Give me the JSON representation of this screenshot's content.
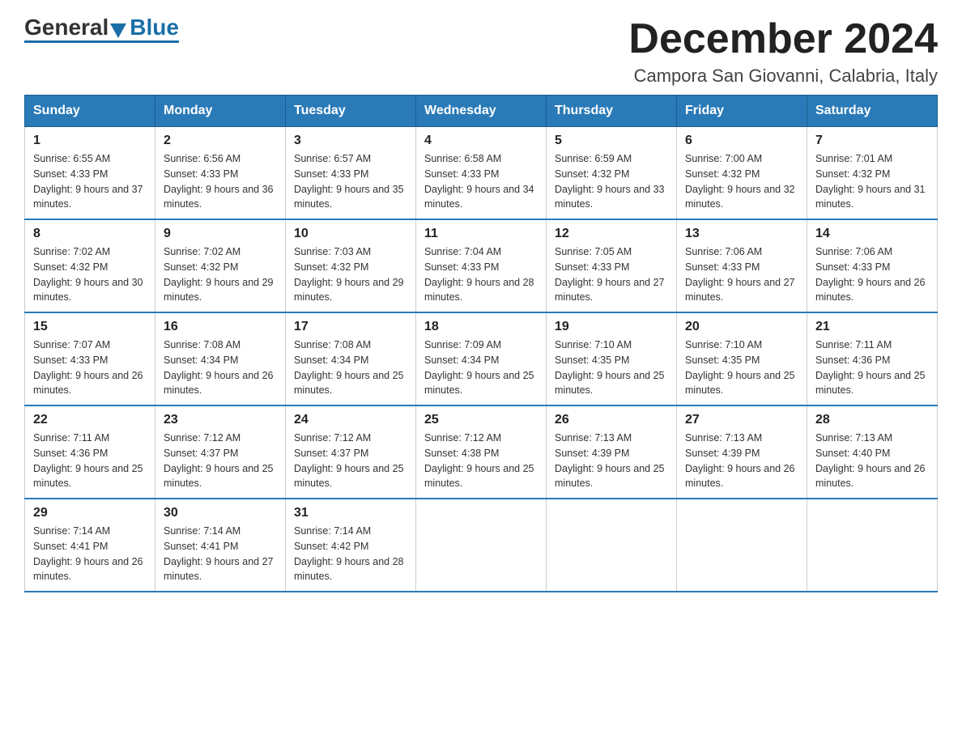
{
  "logo": {
    "general": "General",
    "blue": "Blue"
  },
  "title": "December 2024",
  "subtitle": "Campora San Giovanni, Calabria, Italy",
  "days_of_week": [
    "Sunday",
    "Monday",
    "Tuesday",
    "Wednesday",
    "Thursday",
    "Friday",
    "Saturday"
  ],
  "weeks": [
    [
      {
        "day": "1",
        "sunrise": "6:55 AM",
        "sunset": "4:33 PM",
        "daylight": "9 hours and 37 minutes."
      },
      {
        "day": "2",
        "sunrise": "6:56 AM",
        "sunset": "4:33 PM",
        "daylight": "9 hours and 36 minutes."
      },
      {
        "day": "3",
        "sunrise": "6:57 AM",
        "sunset": "4:33 PM",
        "daylight": "9 hours and 35 minutes."
      },
      {
        "day": "4",
        "sunrise": "6:58 AM",
        "sunset": "4:33 PM",
        "daylight": "9 hours and 34 minutes."
      },
      {
        "day": "5",
        "sunrise": "6:59 AM",
        "sunset": "4:32 PM",
        "daylight": "9 hours and 33 minutes."
      },
      {
        "day": "6",
        "sunrise": "7:00 AM",
        "sunset": "4:32 PM",
        "daylight": "9 hours and 32 minutes."
      },
      {
        "day": "7",
        "sunrise": "7:01 AM",
        "sunset": "4:32 PM",
        "daylight": "9 hours and 31 minutes."
      }
    ],
    [
      {
        "day": "8",
        "sunrise": "7:02 AM",
        "sunset": "4:32 PM",
        "daylight": "9 hours and 30 minutes."
      },
      {
        "day": "9",
        "sunrise": "7:02 AM",
        "sunset": "4:32 PM",
        "daylight": "9 hours and 29 minutes."
      },
      {
        "day": "10",
        "sunrise": "7:03 AM",
        "sunset": "4:32 PM",
        "daylight": "9 hours and 29 minutes."
      },
      {
        "day": "11",
        "sunrise": "7:04 AM",
        "sunset": "4:33 PM",
        "daylight": "9 hours and 28 minutes."
      },
      {
        "day": "12",
        "sunrise": "7:05 AM",
        "sunset": "4:33 PM",
        "daylight": "9 hours and 27 minutes."
      },
      {
        "day": "13",
        "sunrise": "7:06 AM",
        "sunset": "4:33 PM",
        "daylight": "9 hours and 27 minutes."
      },
      {
        "day": "14",
        "sunrise": "7:06 AM",
        "sunset": "4:33 PM",
        "daylight": "9 hours and 26 minutes."
      }
    ],
    [
      {
        "day": "15",
        "sunrise": "7:07 AM",
        "sunset": "4:33 PM",
        "daylight": "9 hours and 26 minutes."
      },
      {
        "day": "16",
        "sunrise": "7:08 AM",
        "sunset": "4:34 PM",
        "daylight": "9 hours and 26 minutes."
      },
      {
        "day": "17",
        "sunrise": "7:08 AM",
        "sunset": "4:34 PM",
        "daylight": "9 hours and 25 minutes."
      },
      {
        "day": "18",
        "sunrise": "7:09 AM",
        "sunset": "4:34 PM",
        "daylight": "9 hours and 25 minutes."
      },
      {
        "day": "19",
        "sunrise": "7:10 AM",
        "sunset": "4:35 PM",
        "daylight": "9 hours and 25 minutes."
      },
      {
        "day": "20",
        "sunrise": "7:10 AM",
        "sunset": "4:35 PM",
        "daylight": "9 hours and 25 minutes."
      },
      {
        "day": "21",
        "sunrise": "7:11 AM",
        "sunset": "4:36 PM",
        "daylight": "9 hours and 25 minutes."
      }
    ],
    [
      {
        "day": "22",
        "sunrise": "7:11 AM",
        "sunset": "4:36 PM",
        "daylight": "9 hours and 25 minutes."
      },
      {
        "day": "23",
        "sunrise": "7:12 AM",
        "sunset": "4:37 PM",
        "daylight": "9 hours and 25 minutes."
      },
      {
        "day": "24",
        "sunrise": "7:12 AM",
        "sunset": "4:37 PM",
        "daylight": "9 hours and 25 minutes."
      },
      {
        "day": "25",
        "sunrise": "7:12 AM",
        "sunset": "4:38 PM",
        "daylight": "9 hours and 25 minutes."
      },
      {
        "day": "26",
        "sunrise": "7:13 AM",
        "sunset": "4:39 PM",
        "daylight": "9 hours and 25 minutes."
      },
      {
        "day": "27",
        "sunrise": "7:13 AM",
        "sunset": "4:39 PM",
        "daylight": "9 hours and 26 minutes."
      },
      {
        "day": "28",
        "sunrise": "7:13 AM",
        "sunset": "4:40 PM",
        "daylight": "9 hours and 26 minutes."
      }
    ],
    [
      {
        "day": "29",
        "sunrise": "7:14 AM",
        "sunset": "4:41 PM",
        "daylight": "9 hours and 26 minutes."
      },
      {
        "day": "30",
        "sunrise": "7:14 AM",
        "sunset": "4:41 PM",
        "daylight": "9 hours and 27 minutes."
      },
      {
        "day": "31",
        "sunrise": "7:14 AM",
        "sunset": "4:42 PM",
        "daylight": "9 hours and 28 minutes."
      },
      null,
      null,
      null,
      null
    ]
  ]
}
